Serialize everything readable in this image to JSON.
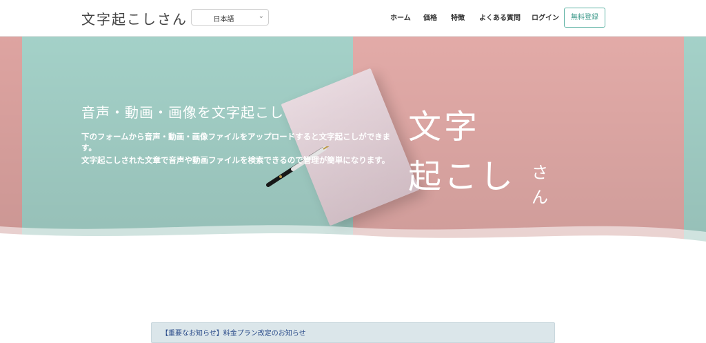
{
  "header": {
    "logo": "文字起こしさん",
    "language": {
      "selected": "日本語"
    },
    "nav": {
      "home": "ホーム",
      "price": "価格",
      "features": "特徴",
      "faq": "よくある質問",
      "login": "ログイン"
    },
    "signup_label": "無料登録"
  },
  "hero": {
    "heading": "音声・動画・画像を文字起こし",
    "desc_1": "下のフォームから音声・動画・画像ファイルをアップロードすると文字起こしができます。",
    "desc_2": "文字起こしされた文章で音声や動画ファイルを検索できるので管理が簡単になります。",
    "title_line1": "文字",
    "title_line2": "起こし",
    "title_small_1": "さ",
    "title_small_2": "ん"
  },
  "notice": {
    "text": "【重要なお知らせ】料金プラン改定のお知らせ"
  },
  "colors": {
    "mint": "#a7d5cc",
    "pink": "#e7aeab",
    "accent": "#5fb3a5"
  }
}
